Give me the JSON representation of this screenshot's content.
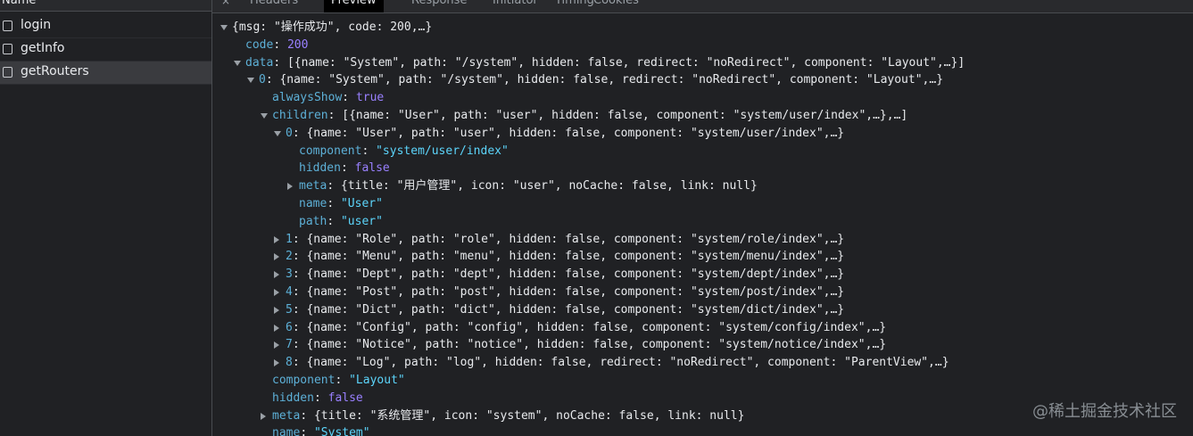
{
  "left_panel": {
    "header": "Name",
    "requests": [
      {
        "name": "login"
      },
      {
        "name": "getInfo"
      },
      {
        "name": "getRouters"
      }
    ]
  },
  "tabs": {
    "close": "×",
    "items": [
      "Headers",
      "Preview",
      "Response",
      "Initiator",
      "Timing",
      "Cookies"
    ],
    "active": "Preview"
  },
  "preview": {
    "lines": [
      {
        "indent": 0,
        "arrow": "down",
        "text": "{msg: \"操作成功\", code: 200,…}"
      },
      {
        "indent": 1,
        "arrow": "",
        "key": "code",
        "value": "200",
        "vtype": "num"
      },
      {
        "indent": 1,
        "arrow": "down",
        "key": "data",
        "value": "[{name: \"System\", path: \"/system\", hidden: false, redirect: \"noRedirect\", component: \"Layout\",…}]",
        "vtype": "plain"
      },
      {
        "indent": 2,
        "arrow": "down",
        "key": "0",
        "value": "{name: \"System\", path: \"/system\", hidden: false, redirect: \"noRedirect\", component: \"Layout\",…}",
        "vtype": "plain"
      },
      {
        "indent": 3,
        "arrow": "",
        "key": "alwaysShow",
        "value": "true",
        "vtype": "kw"
      },
      {
        "indent": 3,
        "arrow": "down",
        "key": "children",
        "value": "[{name: \"User\", path: \"user\", hidden: false, component: \"system/user/index\",…},…]",
        "vtype": "plain"
      },
      {
        "indent": 4,
        "arrow": "down",
        "key": "0",
        "value": "{name: \"User\", path: \"user\", hidden: false, component: \"system/user/index\",…}",
        "vtype": "plain"
      },
      {
        "indent": 5,
        "arrow": "",
        "key": "component",
        "value": "\"system/user/index\"",
        "vtype": "str"
      },
      {
        "indent": 5,
        "arrow": "",
        "key": "hidden",
        "value": "false",
        "vtype": "kw"
      },
      {
        "indent": 5,
        "arrow": "right",
        "key": "meta",
        "value": "{title: \"用户管理\", icon: \"user\", noCache: false, link: null}",
        "vtype": "plain"
      },
      {
        "indent": 5,
        "arrow": "",
        "key": "name",
        "value": "\"User\"",
        "vtype": "str"
      },
      {
        "indent": 5,
        "arrow": "",
        "key": "path",
        "value": "\"user\"",
        "vtype": "str"
      },
      {
        "indent": 4,
        "arrow": "right",
        "key": "1",
        "value": "{name: \"Role\", path: \"role\", hidden: false, component: \"system/role/index\",…}",
        "vtype": "plain"
      },
      {
        "indent": 4,
        "arrow": "right",
        "key": "2",
        "value": "{name: \"Menu\", path: \"menu\", hidden: false, component: \"system/menu/index\",…}",
        "vtype": "plain"
      },
      {
        "indent": 4,
        "arrow": "right",
        "key": "3",
        "value": "{name: \"Dept\", path: \"dept\", hidden: false, component: \"system/dept/index\",…}",
        "vtype": "plain"
      },
      {
        "indent": 4,
        "arrow": "right",
        "key": "4",
        "value": "{name: \"Post\", path: \"post\", hidden: false, component: \"system/post/index\",…}",
        "vtype": "plain"
      },
      {
        "indent": 4,
        "arrow": "right",
        "key": "5",
        "value": "{name: \"Dict\", path: \"dict\", hidden: false, component: \"system/dict/index\",…}",
        "vtype": "plain"
      },
      {
        "indent": 4,
        "arrow": "right",
        "key": "6",
        "value": "{name: \"Config\", path: \"config\", hidden: false, component: \"system/config/index\",…}",
        "vtype": "plain"
      },
      {
        "indent": 4,
        "arrow": "right",
        "key": "7",
        "value": "{name: \"Notice\", path: \"notice\", hidden: false, component: \"system/notice/index\",…}",
        "vtype": "plain"
      },
      {
        "indent": 4,
        "arrow": "right",
        "key": "8",
        "value": "{name: \"Log\", path: \"log\", hidden: false, redirect: \"noRedirect\", component: \"ParentView\",…}",
        "vtype": "plain"
      },
      {
        "indent": 3,
        "arrow": "",
        "key": "component",
        "value": "\"Layout\"",
        "vtype": "str"
      },
      {
        "indent": 3,
        "arrow": "",
        "key": "hidden",
        "value": "false",
        "vtype": "kw"
      },
      {
        "indent": 3,
        "arrow": "right",
        "key": "meta",
        "value": "{title: \"系统管理\", icon: \"system\", noCache: false, link: null}",
        "vtype": "plain"
      },
      {
        "indent": 3,
        "arrow": "",
        "key": "name",
        "value": "\"System\"",
        "vtype": "str"
      }
    ]
  },
  "watermark": "@稀土掘金技术社区",
  "colors": {
    "background": "#202124",
    "key": "#5db0d7",
    "number": "#9980ff",
    "string": "#5cd5fb",
    "selected_row": "#3a3b3f"
  }
}
